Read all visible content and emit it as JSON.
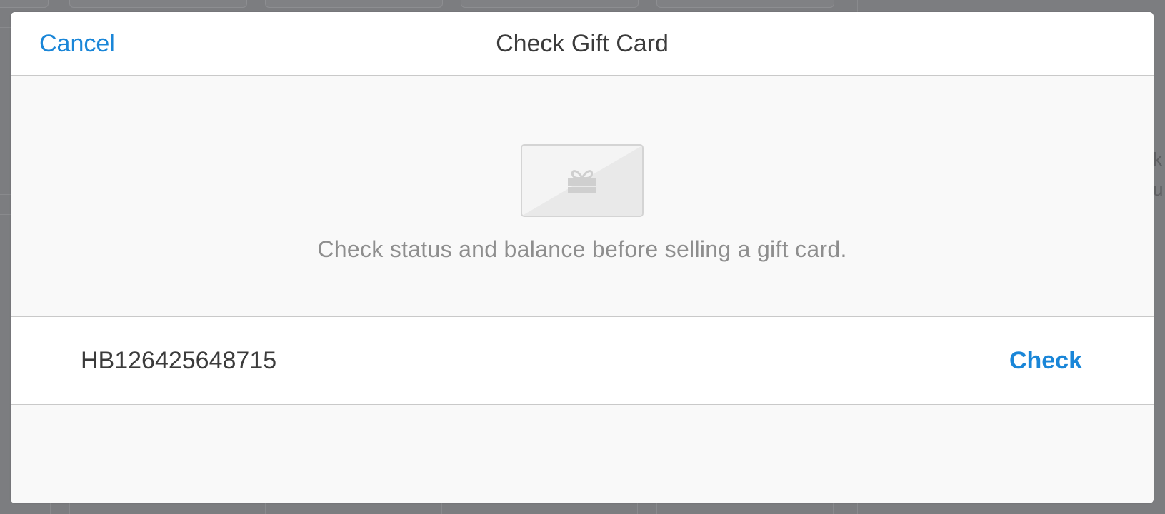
{
  "modal": {
    "title": "Check Gift Card",
    "cancel_label": "Cancel",
    "description": "Check status and balance before selling a gift card.",
    "card_icon": "gift-icon",
    "gift_card_input": {
      "value": "HB126425648715",
      "placeholder": ""
    },
    "check_label": "Check"
  },
  "background": {
    "partial_text_1": "k",
    "partial_text_2": "u"
  },
  "colors": {
    "accent": "#1a86d8",
    "overlay": "#7c7d80",
    "title_text": "#3b3b3b",
    "muted_text": "#8e8e8e"
  }
}
